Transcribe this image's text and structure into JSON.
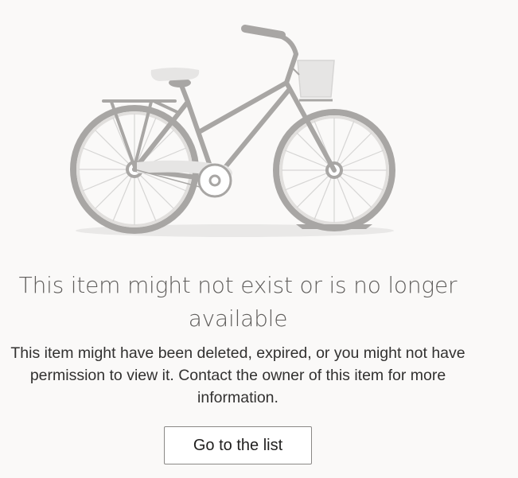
{
  "illustration": {
    "icon": "bicycle-illustration-icon"
  },
  "message": {
    "title": "This item might not exist or is no longer available",
    "description": "This item might have been deleted, expired, or you might not have permission to view it. Contact the owner of this item for more information."
  },
  "actions": {
    "go_to_list_label": "Go to the list"
  },
  "colors": {
    "background": "#faf9f8",
    "illustration_gray": "#a8a6a4",
    "illustration_light": "#e6e5e4",
    "button_border": "#8a8886"
  }
}
